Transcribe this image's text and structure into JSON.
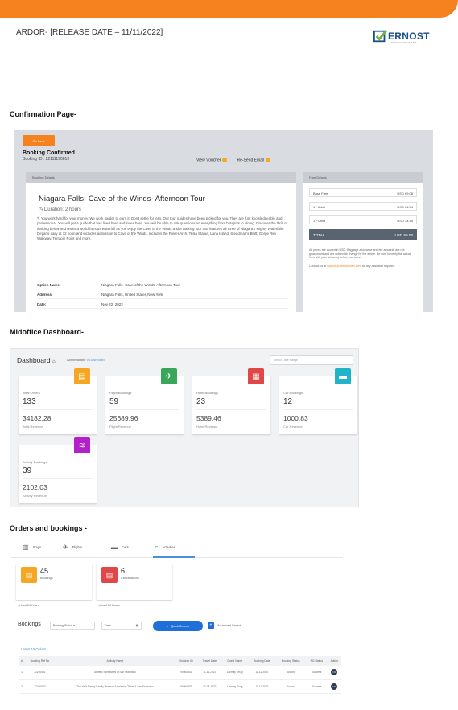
{
  "header": {
    "title": "ARDOR- [RELEASE DATE – 11/11/2022]",
    "logo_text": "ERNOST",
    "logo_tagline": "TRAVELS AND TOURS",
    "banner_color": "#f5821f"
  },
  "sections": {
    "confirmation": "Confirmation Page-",
    "dashboard": "Midoffice Dashboard-",
    "orders": "Orders and bookings -"
  },
  "confirmation": {
    "back_label": "Go back",
    "title": "Booking Confirmed",
    "booking_id": "Booking ID : 22111190819",
    "view_voucher": "View Voucher",
    "resend_email": "Re-Send Email",
    "booking_details_label": "Booking Details",
    "tour_title": "Niagara Falls- Cave of the Winds- Afternoon Tour",
    "duration": "Duration: 2 hours",
    "description": "You work hard for your money. We work harder to earn it. Don't settle for less. Our tour guides have been picked for you. They are fun, knowledgeable and professional. You will get a guide that has lived here and loves here. You will be able to ask questions on everything from hotspots to dining. Discover the thrill of walking below and under a world-famous waterfall as you enjoy the Cave of the Winds and a walking tour that features all three of Niagara's Mighty Waterfalls. Departs daily at 12 noon and includes admission to Cave of the Winds. Includes the Power Arch, Tesla Statue, Luna Island, Steadman's Bluff, Gorge Rim Walkway, Terrapin Point and more.",
    "details": [
      {
        "key": "Option Name:",
        "value": "Niagara Falls- Cave of the Winds- Afternoon Tour"
      },
      {
        "key": "Address:",
        "value": "Niagara Falls, United States,New York"
      },
      {
        "key": "Date:",
        "value": "Nov 22, 2022"
      }
    ],
    "fare": {
      "label": "Fare Details",
      "rows": [
        {
          "label": "Base Fare",
          "value": "USD 69.08"
        },
        {
          "label": "1 * Adult",
          "value": "USD 34.54"
        },
        {
          "label": "1 * Child",
          "value": "USD 34.54"
        }
      ],
      "total_label": "TOTAL",
      "total_value": "USD 69.08",
      "note": "All prices are quoted in USD. Baggage allowance and fee amounts are not guaranteed and are subject to change by the airline. Be sure to verify the actual fees with your airline(s) before you travel.",
      "contact_prefix": "Contact us at",
      "contact_email": "support@ardortravels.com",
      "contact_suffix": "for any assistant required."
    }
  },
  "dashboard": {
    "title": "Dashboard",
    "breadcrumb_admin": "Administrator",
    "breadcrumb_active": "Dashboard",
    "search_placeholder": "Select Date Range",
    "cards": [
      {
        "label": "Total Orders",
        "count": "133",
        "revenue": "34182.28",
        "revenue_label": "Total Revenue",
        "icon": "cart-icon",
        "glyph": "▤",
        "color": "#f5a623"
      },
      {
        "label": "Flight Bookings",
        "count": "59",
        "revenue": "25689.96",
        "revenue_label": "Flight Revenue",
        "icon": "plane-icon",
        "glyph": "✈",
        "color": "#3aa65a"
      },
      {
        "label": "Hotel Bookings",
        "count": "23",
        "revenue": "5389.46",
        "revenue_label": "Hotel Revenue",
        "icon": "hotel-icon",
        "glyph": "▦",
        "color": "#e04848"
      },
      {
        "label": "Car Bookings",
        "count": "12",
        "revenue": "1000.83",
        "revenue_label": "Car Revenue",
        "icon": "car-icon",
        "glyph": "▬",
        "color": "#1fb4c9"
      },
      {
        "label": "Activity Bookings",
        "count": "39",
        "revenue": "2102.03",
        "revenue_label": "Activity Revenue",
        "icon": "activity-icon",
        "glyph": "≋",
        "color": "#b31fc9"
      }
    ]
  },
  "orders": {
    "tabs": [
      {
        "label": "Stays",
        "glyph": "▥"
      },
      {
        "label": "Flights",
        "glyph": "✈"
      },
      {
        "label": "Cars",
        "glyph": "▬"
      },
      {
        "label": "Activities",
        "glyph": "≈"
      }
    ],
    "cards": [
      {
        "count": "45",
        "label": "Bookings",
        "footer": "Last 24 Hours",
        "color": "#f5a623",
        "glyph": "▤"
      },
      {
        "count": "6",
        "label": "Cancellations",
        "footer": "Last 24 Hours",
        "color": "#e04848",
        "glyph": "▤"
      }
    ],
    "bookings_label": "Bookings",
    "status_select": "Booking Status",
    "date_select": "Date",
    "quick_search": "Quick Search",
    "advanced_search": "Advanced Search",
    "latest_label": "Latest 10 Orders",
    "columns": [
      "#",
      "Booking Ref No",
      "Activity Name",
      "Voucher ID",
      "Travel Date",
      "Guest Name",
      "Booking Date",
      "Booking Status",
      "PG Status",
      "Action"
    ],
    "rows": [
      [
        "1",
        "22220661",
        "Athletic Skirmishes of San Francisco",
        "90064802",
        "11-11-2022",
        "Lokmay Leray",
        "11-11-2022",
        "Booked",
        "Success",
        "•••"
      ],
      [
        "2",
        "22220663",
        "The Walt Disney Family Museum Admission Ticket & San Francisco",
        "90064803",
        "12-08-2022",
        "Lokmay Fong",
        "11-11-2022",
        "Booked",
        "Success",
        "•••"
      ]
    ]
  }
}
